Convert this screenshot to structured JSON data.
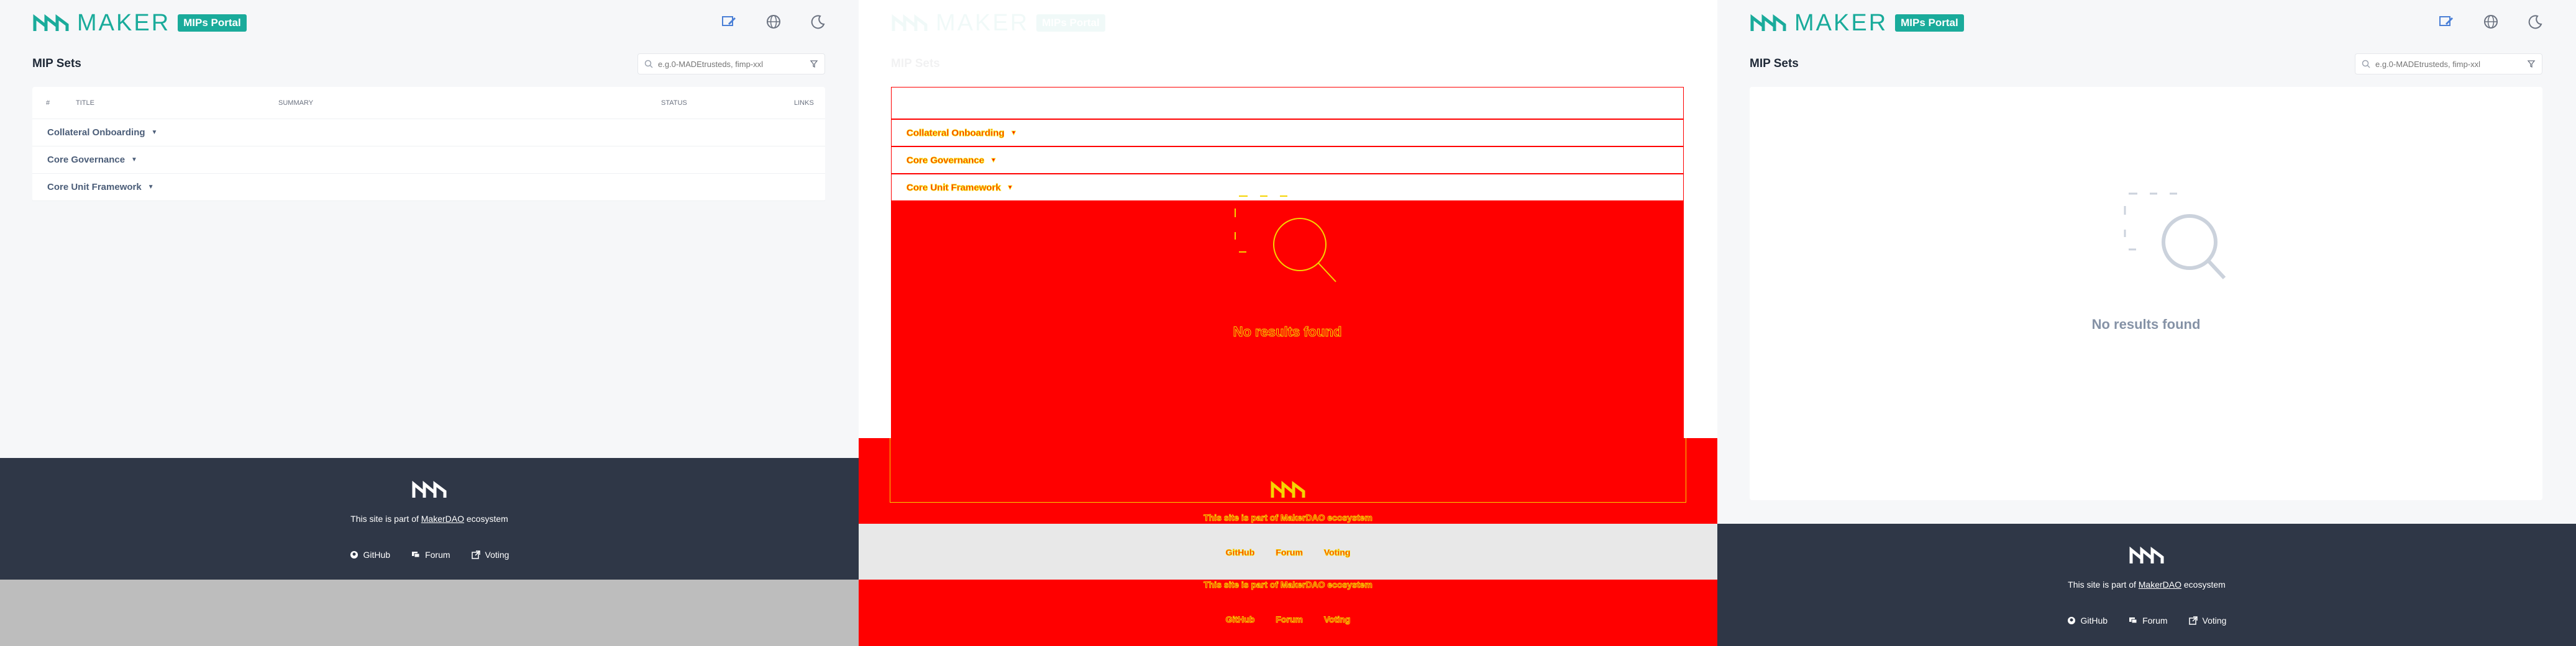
{
  "brand": {
    "name": "MAKER",
    "badge": "MIPs Portal",
    "accent": "#1aab9b"
  },
  "header_icons": [
    "edit-icon",
    "globe-icon",
    "moon-icon"
  ],
  "page": {
    "title": "MIP Sets",
    "search_placeholder": "e.g.0-MADEtrusteds, fimp-xxl"
  },
  "table": {
    "columns": [
      "#",
      "TITLE",
      "SUMMARY",
      "STATUS",
      "LINKS"
    ],
    "rows": [
      {
        "label": "Collateral Onboarding"
      },
      {
        "label": "Core Governance"
      },
      {
        "label": "Core Unit Framework"
      }
    ]
  },
  "empty_state": {
    "text": "No results found"
  },
  "footer": {
    "text_prefix": "This site is part of ",
    "link": "MakerDAO",
    "text_suffix": " ecosystem",
    "links": [
      {
        "label": "GitHub",
        "icon": "github-icon"
      },
      {
        "label": "Forum",
        "icon": "forum-icon"
      },
      {
        "label": "Voting",
        "icon": "external-link-icon"
      }
    ],
    "bg": "#2f3747"
  },
  "debug_colors": {
    "fill": "#ff0000",
    "outline": "#f5d400"
  }
}
